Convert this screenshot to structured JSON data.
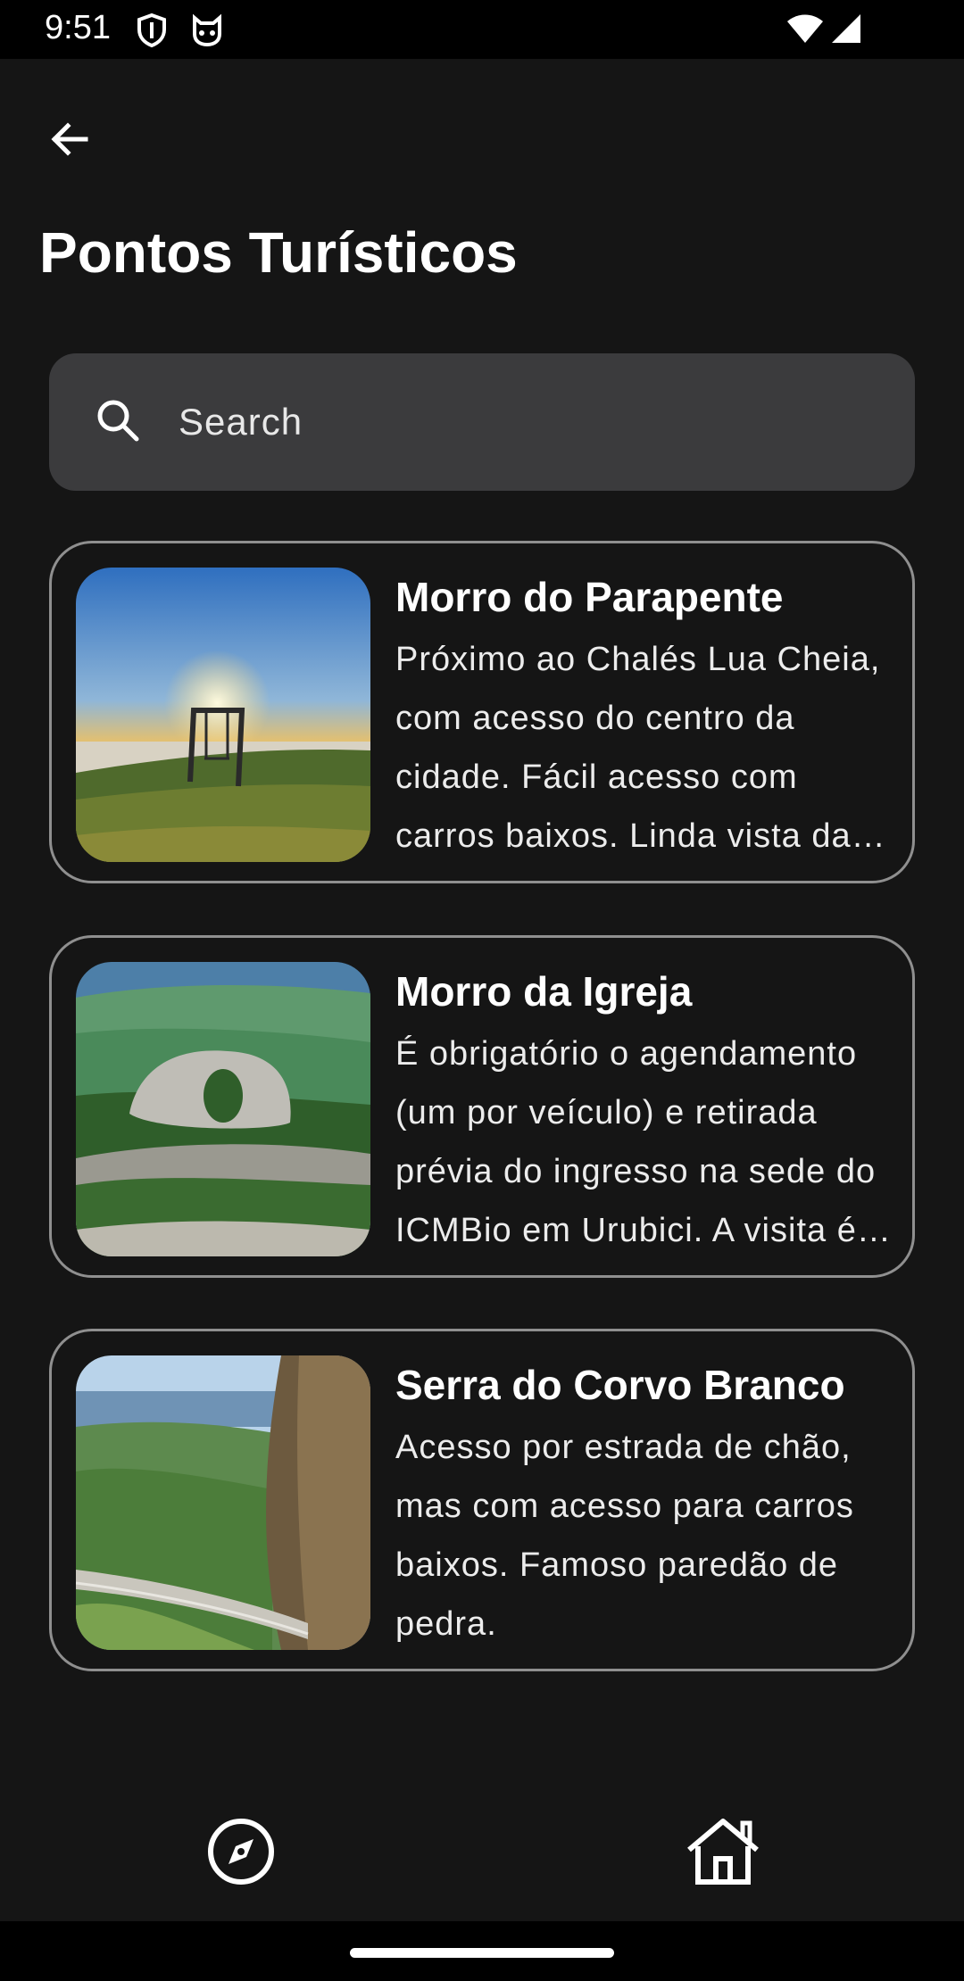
{
  "status_bar": {
    "time": "9:51",
    "icons": [
      "shield-icon",
      "cat-icon",
      "wifi-icon",
      "signal-icon"
    ]
  },
  "header": {
    "back_icon": "arrow-left-icon",
    "title": "Pontos Turísticos"
  },
  "search": {
    "icon": "search-icon",
    "placeholder": "Search",
    "value": ""
  },
  "places": [
    {
      "title": "Morro do Parapente",
      "description": "Próximo ao Chalés Lua Cheia, com acesso do centro da cidade. Fácil acesso com carros baixos. Linda vista da …",
      "image": "sunset-swing-photo"
    },
    {
      "title": "Morro da Igreja",
      "description": "É obrigatório o agendamento (um por veículo) e retirada prévia do ingresso na sede do ICMBio em Urubici. A visita é…",
      "image": "rock-arch-photo"
    },
    {
      "title": "Serra do Corvo Branco",
      "description": "Acesso por estrada de chão, mas com acesso para carros baixos. Famoso paredão de pedra.",
      "image": "mountain-road-photo"
    }
  ],
  "bottom_nav": {
    "items": [
      "compass-icon",
      "home-icon"
    ]
  },
  "colors": {
    "background": "#151515",
    "search_bg": "#3b3b3d",
    "card_border": "#8f8f8f",
    "text": "#ffffff"
  }
}
